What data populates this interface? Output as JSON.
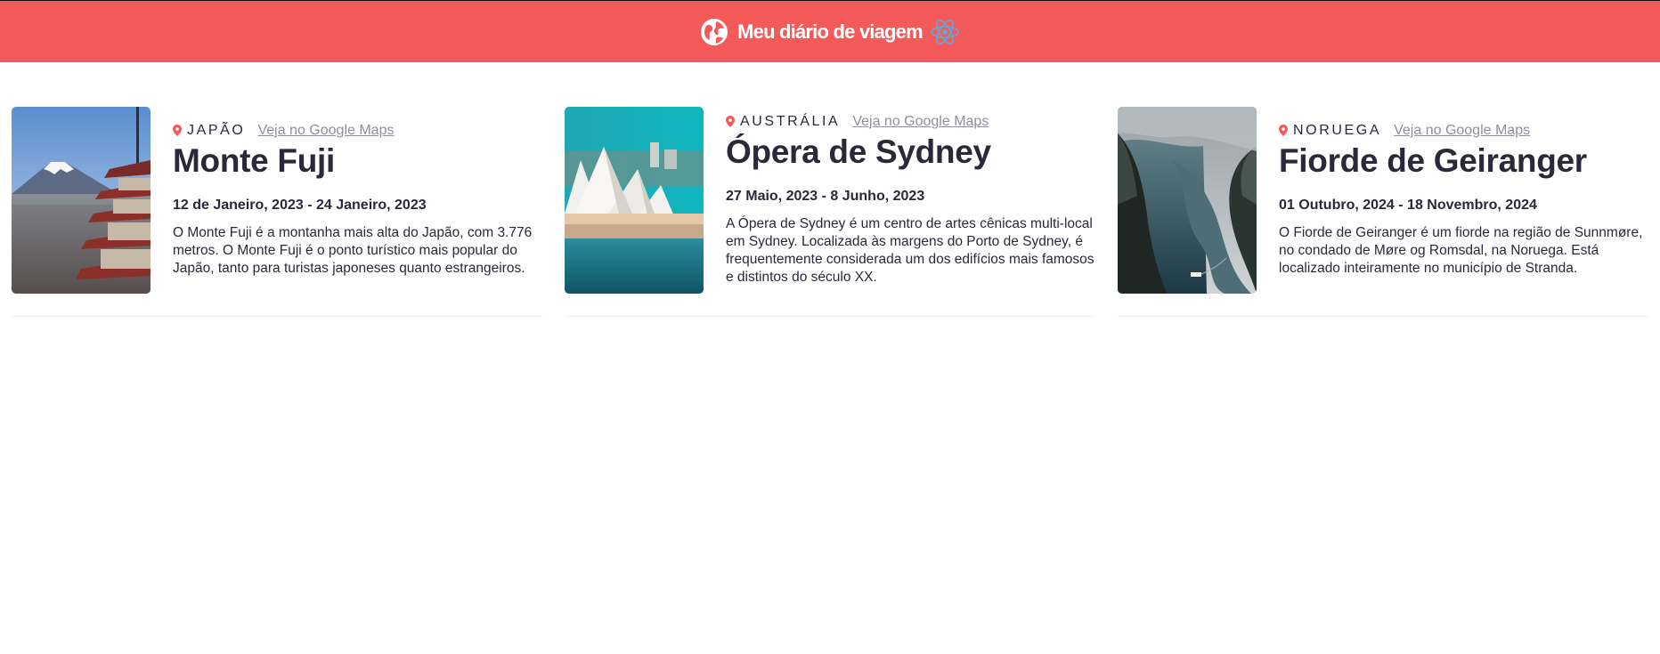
{
  "header": {
    "title": "Meu diário de viagem",
    "icons": [
      "globe-icon",
      "react-logo-icon"
    ]
  },
  "colors": {
    "header_bg": "#f55a5a",
    "text": "#2b283a",
    "link": "#918e9b",
    "pin": "#f55a5a"
  },
  "entries": [
    {
      "country": "JAPÃO",
      "maps_link": "Veja no Google Maps",
      "place": "Monte Fuji",
      "dates": "12 de Janeiro, 2023 - 24 Janeiro, 2023",
      "description": "O Monte Fuji é a montanha mais alta do Japão, com 3.776 metros. O Monte Fuji é o ponto turístico mais popular do Japão, tanto para turistas japoneses quanto estrangeiros."
    },
    {
      "country": "AUSTRÁLIA",
      "maps_link": "Veja no Google Maps",
      "place": "Ópera de Sydney",
      "dates": "27 Maio, 2023 - 8 Junho, 2023",
      "description": "A Ópera de Sydney é um centro de artes cênicas multi-local em Sydney. Localizada às margens do Porto de Sydney, é frequentemente considerada um dos edifícios mais famosos e distintos do século XX."
    },
    {
      "country": "NORUEGA",
      "maps_link": "Veja no Google Maps",
      "place": "Fiorde de Geiranger",
      "dates": "01 Outubro, 2024 - 18 Novembro, 2024",
      "description": "O Fiorde de Geiranger é um fiorde na região de Sunnmøre, no condado de Møre og Romsdal, na Noruega. Está localizado inteiramente no município de Stranda."
    }
  ]
}
